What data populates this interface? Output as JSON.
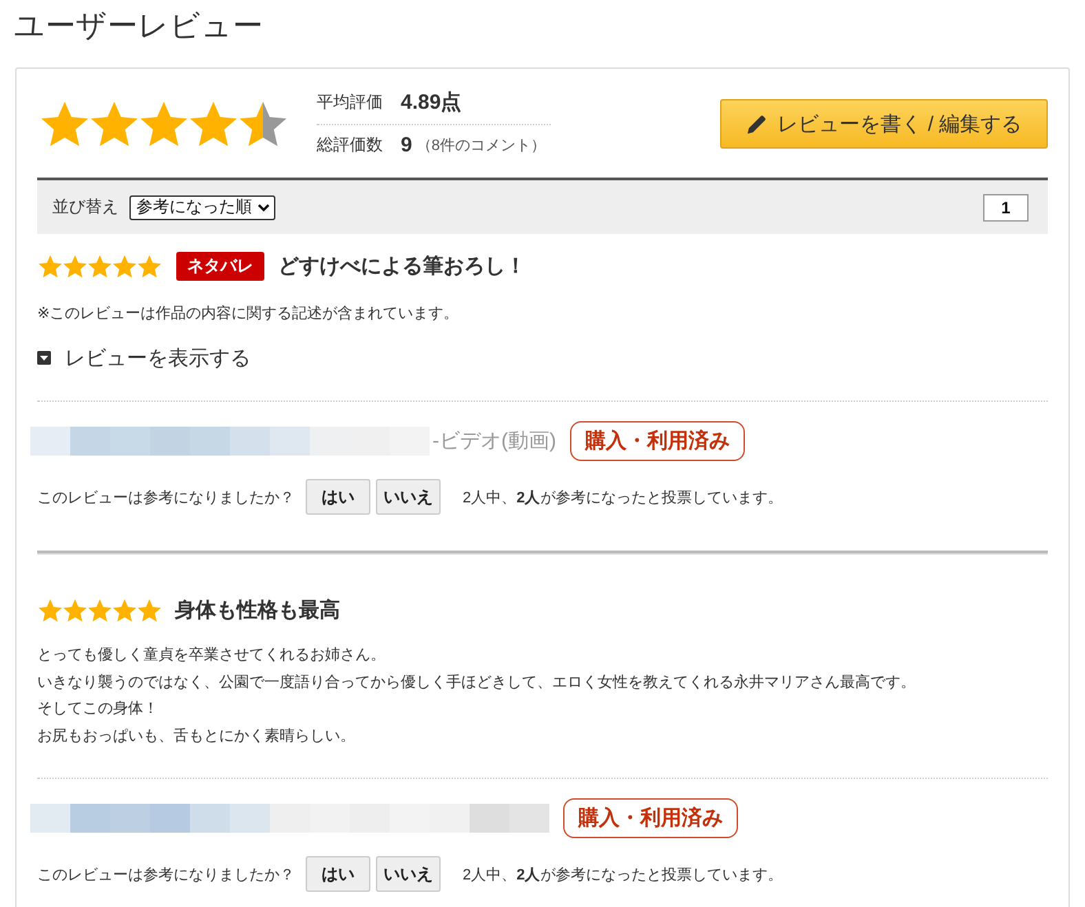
{
  "page": {
    "title": "ユーザーレビュー"
  },
  "summary": {
    "stars": 4.5,
    "average_label": "平均評価",
    "average": "4.89点",
    "total_label": "総評価数",
    "total": "9",
    "comments": "（8件のコメント）"
  },
  "write_button": {
    "label": "レビューを書く / 編集する"
  },
  "sort_bar": {
    "label": "並び替え",
    "select_value": "参考になった順",
    "pages": [
      {
        "label": "1",
        "selected": true
      }
    ]
  },
  "reviews": [
    {
      "kind": "spoiler",
      "stars": 5,
      "spoiler_badge": "ネタバレ",
      "title": "どすけべによる筆おろし！",
      "note": "※このレビューは作品の内容に関する記述が含まれています。",
      "toggle": {
        "label": "レビューを表示する",
        "expanded": false
      },
      "reviewer_suffix": "-ビデオ(動画)",
      "purchase_badge": "購入・利用済み",
      "vote": {
        "prompt": "このレビューは参考になりましたか？",
        "buttons": [
          "はい",
          "いいえ"
        ],
        "result": "2人中、**2人**が参考になったと投票しています。"
      }
    },
    {
      "kind": "full",
      "stars": 5,
      "title": "身体も性格も最高",
      "body": [
        "とっても優しく童貞を卒業させてくれるお姉さん。",
        "いきなり襲うのではなく、公園で一度語り合ってから優しく手ほどきして、エロく女性を教えてくれる永井マリアさん最高です。",
        "そしてこの身体！",
        "お尻もおっぱいも、舌もとにかく素晴らしい。"
      ],
      "purchase_badge": "購入・利用済み",
      "vote": {
        "prompt": "このレビューは参考になりましたか？",
        "buttons": [
          "はい",
          "いいえ"
        ],
        "result": "2人中、**2人**が参考になったと投票しています。"
      }
    }
  ]
}
